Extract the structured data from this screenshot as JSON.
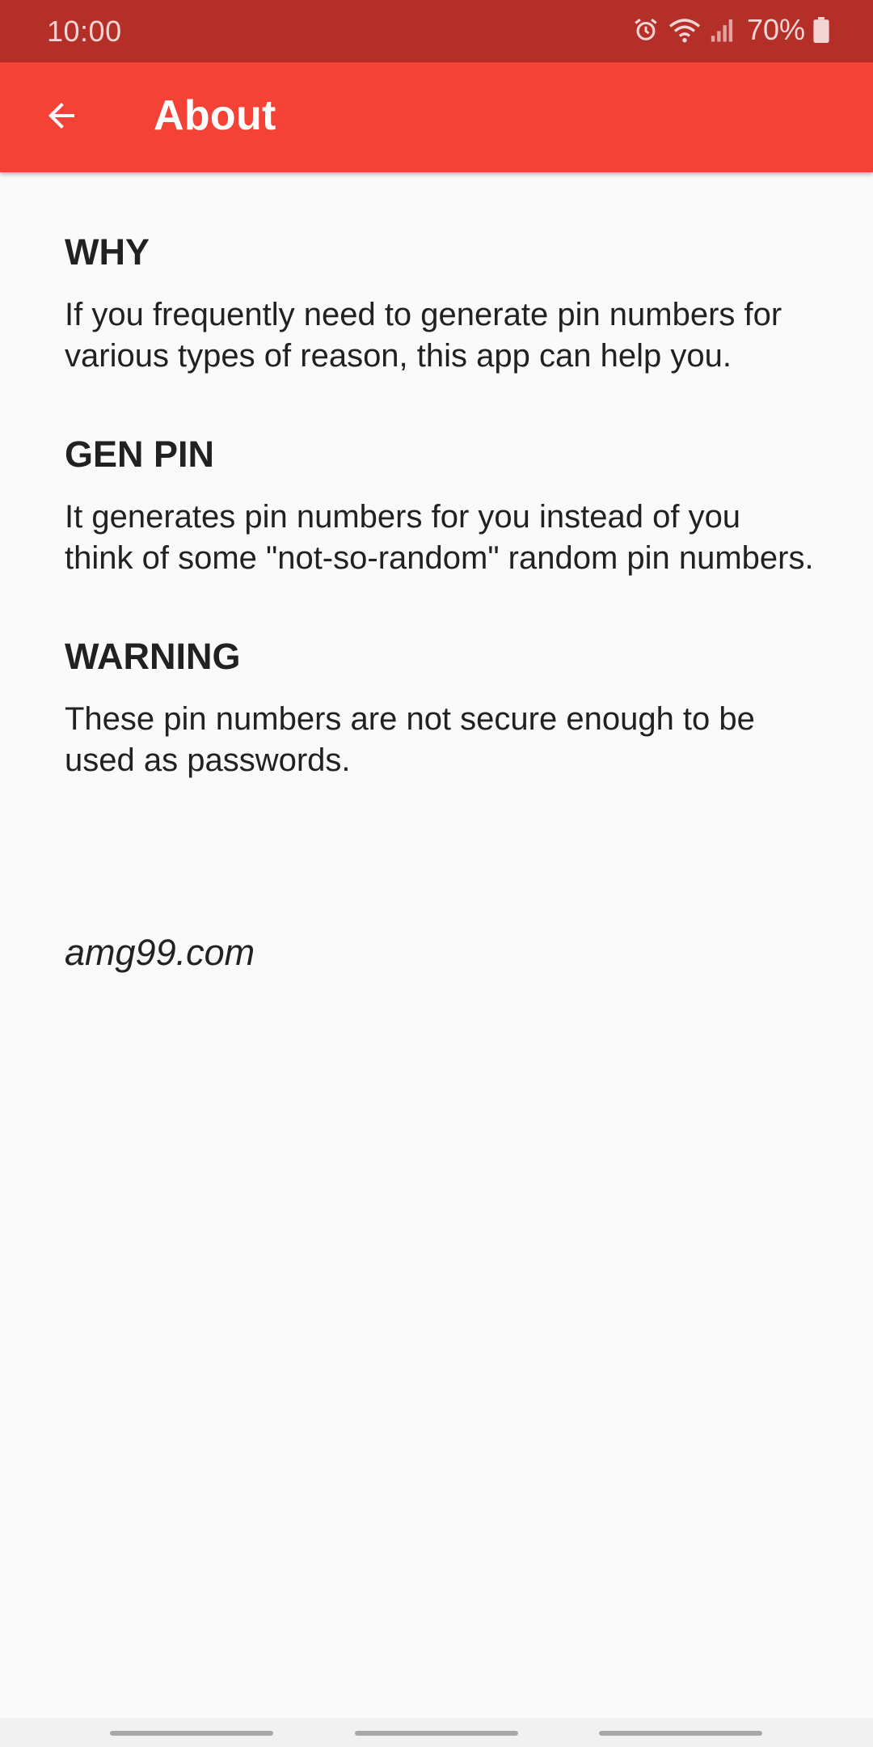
{
  "status_bar": {
    "time": "10:00",
    "battery_percent": "70%",
    "icons": [
      "alarm-icon",
      "wifi-icon",
      "signal-icon",
      "battery-icon"
    ]
  },
  "app_bar": {
    "title": "About",
    "back_icon": "arrow-back-icon",
    "background_color": "#f44336"
  },
  "sections": [
    {
      "title": "WHY",
      "text": "If you frequently need to generate pin numbers for various types of reason, this app can help you."
    },
    {
      "title": "GEN PIN",
      "text": "It generates pin numbers for you instead of you think of some \"not-so-random\" random pin numbers."
    },
    {
      "title": "WARNING",
      "text": "These pin numbers are not secure enough to be used as passwords."
    }
  ],
  "footer_link": "amg99.com"
}
